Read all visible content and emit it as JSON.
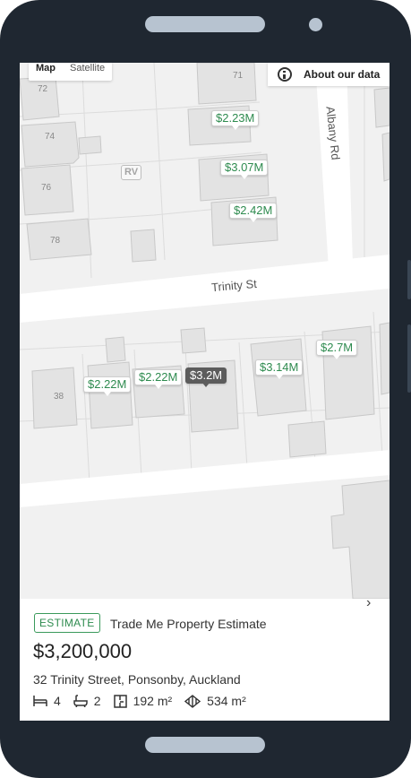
{
  "map": {
    "mode_tabs": [
      "Map",
      "Satellite"
    ],
    "about_label": "About our data",
    "road_labels": {
      "horizontal": "Trinity St",
      "vertical": "Albany Rd"
    },
    "lot_numbers": [
      "72",
      "71",
      "74",
      "76",
      "78",
      "38"
    ],
    "rv_marker": "RV",
    "price_pins": [
      {
        "label": "$2.23M",
        "selected": false
      },
      {
        "label": "$3.07M",
        "selected": false
      },
      {
        "label": "$2.42M",
        "selected": false
      },
      {
        "label": "$2.7M",
        "selected": false
      },
      {
        "label": "$3.14M",
        "selected": false
      },
      {
        "label": "$3.2M",
        "selected": true
      },
      {
        "label": "$2.22M",
        "selected": false
      },
      {
        "label": "$2.22M",
        "selected": false
      }
    ]
  },
  "card": {
    "badge": "ESTIMATE",
    "title": "Trade Me Property Estimate",
    "price": "$3,200,000",
    "address": "32 Trinity Street, Ponsonby, Auckland",
    "features": {
      "bedrooms": "4",
      "bathrooms": "2",
      "floor_area": "192 m²",
      "land_area": "534 m²"
    }
  },
  "colors": {
    "phone": "#1f2731",
    "accent_green": "#2e8b4f",
    "selected_pin": "#5c5c5c",
    "map_bg": "#f1f1f1"
  }
}
